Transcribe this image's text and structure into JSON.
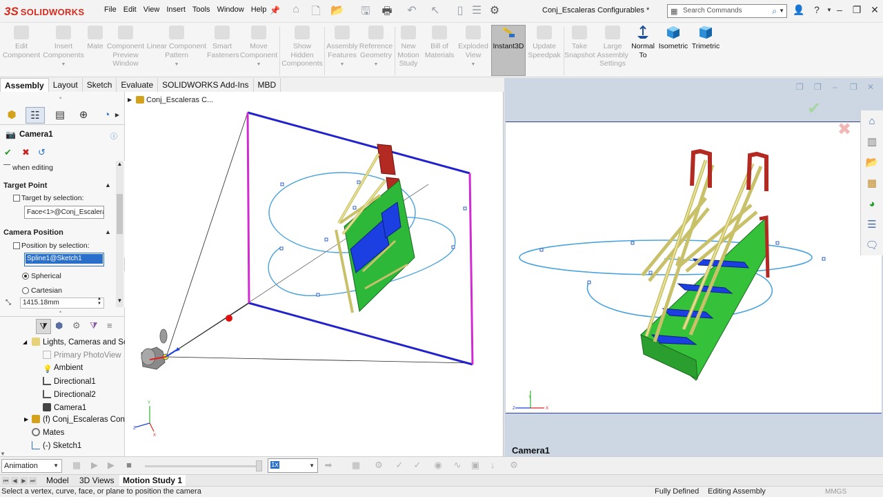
{
  "app": {
    "logo_mark": "3S",
    "logo_text": "SOLIDWORKS",
    "document_title": "Conj_Escaleras Configurables *"
  },
  "menu": [
    "File",
    "Edit",
    "View",
    "Insert",
    "Tools",
    "Window",
    "Help"
  ],
  "search": {
    "placeholder": "Search Commands"
  },
  "ribbon": {
    "edit_component": "Edit\nComponent",
    "insert_components": "Insert\nComponents",
    "mate": "Mate",
    "component_preview": "Component\nPreview\nWindow",
    "linear_pattern": "Linear Component\nPattern",
    "smart_fasteners": "Smart\nFasteners",
    "move_component": "Move\nComponent",
    "show_hidden": "Show\nHidden\nComponents",
    "assembly_features": "Assembly\nFeatures",
    "reference_geometry": "Reference\nGeometry",
    "new_motion_study": "New\nMotion\nStudy",
    "bill_of_materials": "Bill of\nMaterials",
    "exploded_view": "Exploded\nView",
    "instant3d": "Instant3D",
    "update_speedpak": "Update\nSpeedpak",
    "take_snapshot": "Take\nSnapshot",
    "large_assembly": "Large\nAssembly\nSettings",
    "normal_to": "Normal\nTo",
    "isometric": "Isometric",
    "trimetric": "Trimetric"
  },
  "cmd_tabs": [
    "Assembly",
    "Layout",
    "Sketch",
    "Evaluate",
    "SOLIDWORKS Add-Ins",
    "MBD"
  ],
  "property_manager": {
    "title": "Camera1",
    "when_editing": "when editing",
    "target_point_header": "Target Point",
    "target_by_selection": "Target by selection:",
    "target_field": "Face<1>@Conj_Escaleras",
    "camera_position_header": "Camera Position",
    "position_by_selection": "Position by selection:",
    "position_field": "Spline1@Sketch1",
    "spherical": "Spherical",
    "cartesian": "Cartesian",
    "distance": "1415.18mm"
  },
  "feature_tree": {
    "root": "Conj_Escaleras C...",
    "items": [
      {
        "label": "Lights, Cameras and Sc",
        "dim": false
      },
      {
        "label": "Primary PhotoView",
        "dim": true
      },
      {
        "label": "Ambient",
        "dim": false
      },
      {
        "label": "Directional1",
        "dim": false
      },
      {
        "label": "Directional2",
        "dim": false
      },
      {
        "label": "Camera1",
        "dim": false
      },
      {
        "label": "(f) Conj_Escaleras Confi",
        "dim": false
      },
      {
        "label": "Mates",
        "dim": false
      },
      {
        "label": "(-) Sketch1",
        "dim": false
      }
    ]
  },
  "viewport_right": {
    "label": "Camera1"
  },
  "motion": {
    "type": "Animation",
    "speed": "1x"
  },
  "bottom_tabs": [
    "Model",
    "3D Views",
    "Motion Study 1"
  ],
  "status": {
    "message": "Select a vertex, curve, face, or plane to position the camera",
    "defined": "Fully Defined",
    "editing": "Editing Assembly",
    "units": "MMGS"
  },
  "colors": {
    "accent": "#2a6fc9",
    "brand": "#d52b1e",
    "frame_blue": "#2222cc",
    "frame_magenta": "#d22ad2",
    "spline": "#4aa3dc",
    "rail_yellow": "#e6e07a",
    "step_green": "#35c23a",
    "tread_blue": "#1b3fe0",
    "handrail_red": "#c0221f"
  }
}
